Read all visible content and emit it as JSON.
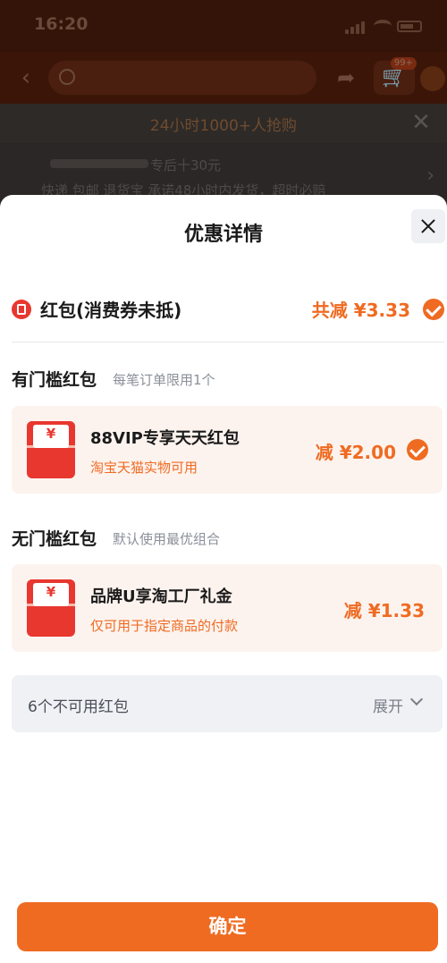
{
  "background": {
    "status_time": "16:20",
    "promo_text": "24小时1000+人抢购",
    "info_line1": "专后十30元",
    "info_line2": "快递 包邮  退货宝  承诺48小时内发货，超时必赔",
    "cart_badge": "99+"
  },
  "sheet": {
    "title": "优惠详情",
    "summary": {
      "label": "红包(消费券未抵)",
      "amount": "共减 ¥3.33",
      "checked": true
    },
    "threshold_section": {
      "title": "有门槛红包",
      "subtitle": "每笔订单限用1个",
      "coupon": {
        "yen_symbol": "¥",
        "name": "88VIP专享天天红包",
        "note": "淘宝天猫实物可用",
        "amount": "减 ¥2.00",
        "checked": true
      }
    },
    "no_threshold_section": {
      "title": "无门槛红包",
      "subtitle": "默认使用最优组合",
      "coupon": {
        "yen_symbol": "¥",
        "name": "品牌U享淘工厂礼金",
        "note": "仅可用于指定商品的付款",
        "amount": "减 ¥1.33",
        "checked": false
      }
    },
    "unavailable": {
      "label": "6个不可用红包",
      "expand_label": "展开"
    },
    "confirm_label": "确定"
  },
  "colors": {
    "accent": "#ef6b22",
    "red_packet": "#e8372f",
    "coupon_bg": "#fdf3ee"
  }
}
